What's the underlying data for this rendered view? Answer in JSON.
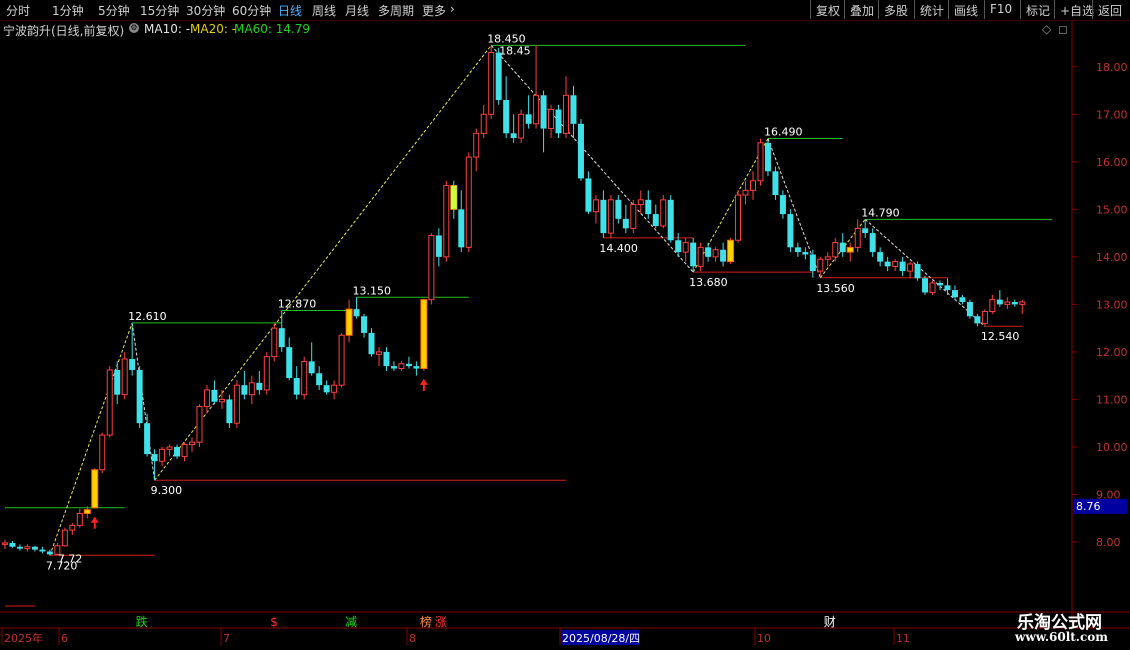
{
  "toolbar": {
    "periods": [
      "分时",
      "1分钟",
      "5分钟",
      "15分钟",
      "30分钟",
      "60分钟",
      "日线",
      "周线",
      "月线",
      "多周期",
      "更多"
    ],
    "active_period": "日线",
    "right_buttons": [
      "复权",
      "叠加",
      "多股",
      "统计",
      "画线",
      "F10",
      "标记",
      "+自选",
      "返回"
    ]
  },
  "infobar": {
    "stock_name": "宁波韵升(日线,前复权)",
    "ma10": "MA10: -",
    "ma20": "MA20: -",
    "ma60": "MA60: 14.79",
    "ma60_color": "#20d020"
  },
  "watermark": {
    "title": "乐淘公式网",
    "url": "www.60lt.com"
  },
  "chart_data": {
    "type": "candlestick",
    "ylim": [
      7.6,
      18.9
    ],
    "yticks": [
      "18.00",
      "17.00",
      "16.00",
      "15.00",
      "14.00",
      "13.00",
      "12.00",
      "11.00",
      "10.00",
      "9.00",
      "8.00"
    ],
    "current_price_tag": "8.76",
    "x_labels": [
      "2025年",
      "6",
      "7",
      "8",
      "2025/08/28/四",
      "10",
      "11"
    ],
    "candles": [
      [
        7.95,
        8.05,
        7.85,
        7.98
      ],
      [
        7.98,
        8.02,
        7.88,
        7.9
      ],
      [
        7.9,
        7.95,
        7.82,
        7.86
      ],
      [
        7.86,
        7.95,
        7.8,
        7.9
      ],
      [
        7.9,
        7.92,
        7.8,
        7.84
      ],
      [
        7.84,
        7.9,
        7.76,
        7.8
      ],
      [
        7.8,
        7.84,
        7.72,
        7.74
      ],
      [
        7.74,
        7.98,
        7.72,
        7.92
      ],
      [
        7.92,
        8.3,
        7.9,
        8.25
      ],
      [
        8.25,
        8.4,
        8.15,
        8.35
      ],
      [
        8.35,
        8.7,
        8.3,
        8.6
      ],
      [
        8.6,
        8.75,
        8.5,
        8.68
      ],
      [
        8.72,
        9.55,
        8.7,
        9.52
      ],
      [
        9.52,
        10.3,
        9.45,
        10.25
      ],
      [
        10.25,
        11.7,
        10.2,
        11.62
      ],
      [
        11.62,
        11.8,
        10.9,
        11.1
      ],
      [
        11.1,
        12.0,
        11.0,
        11.85
      ],
      [
        11.85,
        12.61,
        11.5,
        11.62
      ],
      [
        11.62,
        11.7,
        10.4,
        10.5
      ],
      [
        10.5,
        10.7,
        9.8,
        9.85
      ],
      [
        9.85,
        9.95,
        9.3,
        9.7
      ],
      [
        9.7,
        10.0,
        9.6,
        9.95
      ],
      [
        9.95,
        10.05,
        9.8,
        10.0
      ],
      [
        10.0,
        10.05,
        9.75,
        9.8
      ],
      [
        9.8,
        10.1,
        9.7,
        10.05
      ],
      [
        10.05,
        10.2,
        9.9,
        10.1
      ],
      [
        10.1,
        10.9,
        10.0,
        10.85
      ],
      [
        10.85,
        11.3,
        10.7,
        11.2
      ],
      [
        11.2,
        11.4,
        10.9,
        10.95
      ],
      [
        10.95,
        11.2,
        10.8,
        11.0
      ],
      [
        11.0,
        11.1,
        10.4,
        10.5
      ],
      [
        10.5,
        11.4,
        10.4,
        11.3
      ],
      [
        11.3,
        11.6,
        11.0,
        11.1
      ],
      [
        11.1,
        11.5,
        10.9,
        11.35
      ],
      [
        11.35,
        11.6,
        11.1,
        11.2
      ],
      [
        11.2,
        12.0,
        11.1,
        11.9
      ],
      [
        11.9,
        12.6,
        11.8,
        12.5
      ],
      [
        12.5,
        12.87,
        12.0,
        12.1
      ],
      [
        12.1,
        12.3,
        11.4,
        11.45
      ],
      [
        11.45,
        11.7,
        11.0,
        11.1
      ],
      [
        11.1,
        11.9,
        11.0,
        11.8
      ],
      [
        11.8,
        12.2,
        11.5,
        11.55
      ],
      [
        11.55,
        11.7,
        11.2,
        11.3
      ],
      [
        11.3,
        11.4,
        11.1,
        11.15
      ],
      [
        11.15,
        11.4,
        11.0,
        11.3
      ],
      [
        11.3,
        12.4,
        11.25,
        12.35
      ],
      [
        12.35,
        13.1,
        12.2,
        12.9
      ],
      [
        12.9,
        13.15,
        12.7,
        12.75
      ],
      [
        12.75,
        12.8,
        12.3,
        12.4
      ],
      [
        12.4,
        12.5,
        11.9,
        11.95
      ],
      [
        11.95,
        12.1,
        11.7,
        12.0
      ],
      [
        12.0,
        12.1,
        11.6,
        11.7
      ],
      [
        11.7,
        11.8,
        11.6,
        11.65
      ],
      [
        11.65,
        11.8,
        11.6,
        11.75
      ],
      [
        11.75,
        11.9,
        11.65,
        11.7
      ],
      [
        11.7,
        11.8,
        11.5,
        11.65
      ],
      [
        11.65,
        13.12,
        11.6,
        13.1
      ],
      [
        13.1,
        14.5,
        13.0,
        14.45
      ],
      [
        14.45,
        14.6,
        13.8,
        14.0
      ],
      [
        14.0,
        15.6,
        13.9,
        15.5
      ],
      [
        15.5,
        15.6,
        14.8,
        15.0
      ],
      [
        15.0,
        15.4,
        14.1,
        14.2
      ],
      [
        14.2,
        16.2,
        14.1,
        16.1
      ],
      [
        16.1,
        16.7,
        15.8,
        16.6
      ],
      [
        16.6,
        17.2,
        16.5,
        17.0
      ],
      [
        17.0,
        18.45,
        16.9,
        18.3
      ],
      [
        18.3,
        18.4,
        17.2,
        17.3
      ],
      [
        17.3,
        17.8,
        16.5,
        16.6
      ],
      [
        16.6,
        17.0,
        16.4,
        16.5
      ],
      [
        16.5,
        17.1,
        16.4,
        17.0
      ],
      [
        17.0,
        17.4,
        16.7,
        16.8
      ],
      [
        16.8,
        18.45,
        16.7,
        17.4
      ],
      [
        17.4,
        17.5,
        16.2,
        16.7
      ],
      [
        16.7,
        17.2,
        16.5,
        17.1
      ],
      [
        17.1,
        17.2,
        16.5,
        16.6
      ],
      [
        16.6,
        17.8,
        16.5,
        17.4
      ],
      [
        17.4,
        17.6,
        16.5,
        16.8
      ],
      [
        16.8,
        16.9,
        15.6,
        15.65
      ],
      [
        15.65,
        15.8,
        14.9,
        14.95
      ],
      [
        14.95,
        15.3,
        14.7,
        15.2
      ],
      [
        15.2,
        15.4,
        14.4,
        14.5
      ],
      [
        14.5,
        15.3,
        14.4,
        15.2
      ],
      [
        15.2,
        15.3,
        14.7,
        14.8
      ],
      [
        14.8,
        15.1,
        14.5,
        14.6
      ],
      [
        14.6,
        15.2,
        14.5,
        15.1
      ],
      [
        15.1,
        15.4,
        14.9,
        15.2
      ],
      [
        15.2,
        15.4,
        14.8,
        14.9
      ],
      [
        14.9,
        15.1,
        14.6,
        14.65
      ],
      [
        14.65,
        15.3,
        14.6,
        15.2
      ],
      [
        15.2,
        15.3,
        14.3,
        14.35
      ],
      [
        14.35,
        14.5,
        14.0,
        14.1
      ],
      [
        14.1,
        14.4,
        13.9,
        14.3
      ],
      [
        14.3,
        14.4,
        13.68,
        13.8
      ],
      [
        13.8,
        14.3,
        13.7,
        14.2
      ],
      [
        14.2,
        14.3,
        13.9,
        14.0
      ],
      [
        14.0,
        14.2,
        13.9,
        14.15
      ],
      [
        14.15,
        14.3,
        13.8,
        13.9
      ],
      [
        13.9,
        14.4,
        13.85,
        14.35
      ],
      [
        14.35,
        15.4,
        14.3,
        15.3
      ],
      [
        15.3,
        15.6,
        15.1,
        15.4
      ],
      [
        15.4,
        15.8,
        15.2,
        15.6
      ],
      [
        15.6,
        16.49,
        15.5,
        16.4
      ],
      [
        16.4,
        16.45,
        15.7,
        15.8
      ],
      [
        15.8,
        15.9,
        15.2,
        15.3
      ],
      [
        15.3,
        15.4,
        14.8,
        14.9
      ],
      [
        14.9,
        15.0,
        14.1,
        14.2
      ],
      [
        14.2,
        14.3,
        14.0,
        14.1
      ],
      [
        14.1,
        14.2,
        13.95,
        14.05
      ],
      [
        14.05,
        14.15,
        13.56,
        13.7
      ],
      [
        13.7,
        14.0,
        13.6,
        13.95
      ],
      [
        13.95,
        14.1,
        13.8,
        14.0
      ],
      [
        14.0,
        14.4,
        13.9,
        14.3
      ],
      [
        14.3,
        14.5,
        14.0,
        14.1
      ],
      [
        14.1,
        14.3,
        13.9,
        14.2
      ],
      [
        14.2,
        14.79,
        14.1,
        14.6
      ],
      [
        14.6,
        14.79,
        14.4,
        14.5
      ],
      [
        14.5,
        14.6,
        14.0,
        14.1
      ],
      [
        14.1,
        14.2,
        13.8,
        13.9
      ],
      [
        13.9,
        14.0,
        13.7,
        13.8
      ],
      [
        13.8,
        13.95,
        13.7,
        13.9
      ],
      [
        13.9,
        14.0,
        13.6,
        13.7
      ],
      [
        13.7,
        13.9,
        13.55,
        13.85
      ],
      [
        13.85,
        13.9,
        13.5,
        13.55
      ],
      [
        13.55,
        13.6,
        13.2,
        13.25
      ],
      [
        13.25,
        13.5,
        13.2,
        13.45
      ],
      [
        13.45,
        13.5,
        13.3,
        13.4
      ],
      [
        13.4,
        13.55,
        13.2,
        13.3
      ],
      [
        13.3,
        13.4,
        13.1,
        13.15
      ],
      [
        13.15,
        13.2,
        13.0,
        13.05
      ],
      [
        13.05,
        13.1,
        12.7,
        12.75
      ],
      [
        12.75,
        12.8,
        12.54,
        12.6
      ],
      [
        12.6,
        12.9,
        12.55,
        12.85
      ],
      [
        12.85,
        13.2,
        12.8,
        13.1
      ],
      [
        13.1,
        13.3,
        12.95,
        13.0
      ],
      [
        13.0,
        13.15,
        12.9,
        13.05
      ],
      [
        13.05,
        13.1,
        12.95,
        13.0
      ],
      [
        13.0,
        13.1,
        12.8,
        13.05
      ]
    ],
    "pivots": [
      {
        "label": "7.720",
        "value": 7.72,
        "index": 6,
        "pos": "low"
      },
      {
        "label": "7.72",
        "value": 7.72,
        "index": 6,
        "pos": "low2"
      },
      {
        "label": "12.610",
        "value": 12.61,
        "index": 17,
        "pos": "high"
      },
      {
        "label": "9.300",
        "value": 9.3,
        "index": 20,
        "pos": "low"
      },
      {
        "label": "12.870",
        "value": 12.87,
        "index": 37,
        "pos": "high"
      },
      {
        "label": "13.150",
        "value": 13.15,
        "index": 47,
        "pos": "high"
      },
      {
        "label": "18.450",
        "value": 18.45,
        "index": 65,
        "pos": "high"
      },
      {
        "label": "18.45",
        "value": 18.45,
        "index": 65,
        "pos": "high2"
      },
      {
        "label": "14.400",
        "value": 14.4,
        "index": 80,
        "pos": "low"
      },
      {
        "label": "13.680",
        "value": 13.68,
        "index": 92,
        "pos": "low"
      },
      {
        "label": "16.490",
        "value": 16.49,
        "index": 102,
        "pos": "high"
      },
      {
        "label": "13.560",
        "value": 13.56,
        "index": 109,
        "pos": "low"
      },
      {
        "label": "14.790",
        "value": 14.79,
        "index": 115,
        "pos": "high"
      },
      {
        "label": "12.540",
        "value": 12.54,
        "index": 131,
        "pos": "low"
      }
    ],
    "support_lines": [
      {
        "value": 8.72,
        "from": 0,
        "to": 16,
        "color": "green"
      },
      {
        "value": 7.72,
        "from": 6,
        "to": 20,
        "color": "red"
      },
      {
        "value": 12.61,
        "from": 17,
        "to": 37,
        "color": "green"
      },
      {
        "value": 12.87,
        "from": 37,
        "to": 46,
        "color": "green"
      },
      {
        "value": 13.15,
        "from": 47,
        "to": 62,
        "color": "green"
      },
      {
        "value": 9.3,
        "from": 20,
        "to": 75,
        "color": "red"
      },
      {
        "value": 18.45,
        "from": 65,
        "to": 99,
        "color": "green"
      },
      {
        "value": 14.4,
        "from": 80,
        "to": 92,
        "color": "red"
      },
      {
        "value": 16.49,
        "from": 102,
        "to": 112,
        "color": "green"
      },
      {
        "value": 13.68,
        "from": 92,
        "to": 108,
        "color": "red"
      },
      {
        "value": 13.56,
        "from": 109,
        "to": 126,
        "color": "red"
      },
      {
        "value": 14.79,
        "from": 115,
        "to": 140,
        "color": "green"
      },
      {
        "value": 12.54,
        "from": 131,
        "to": 136,
        "color": "red"
      }
    ],
    "highlighted_candles": [
      11,
      12,
      46,
      56,
      60,
      97,
      113
    ],
    "up_arrows": [
      12,
      56
    ],
    "signals": [
      {
        "label": "跌",
        "index": 18,
        "color": "#20d020"
      },
      {
        "label": "$",
        "index": 36,
        "color": "#ff3030"
      },
      {
        "label": "减",
        "index": 46,
        "color": "#20d020"
      },
      {
        "label": "榜",
        "index": 56,
        "color": "#ff8c40"
      },
      {
        "label": "涨",
        "index": 58,
        "color": "#ff3030"
      },
      {
        "label": "财",
        "index": 110,
        "color": "#ffffff"
      }
    ]
  }
}
